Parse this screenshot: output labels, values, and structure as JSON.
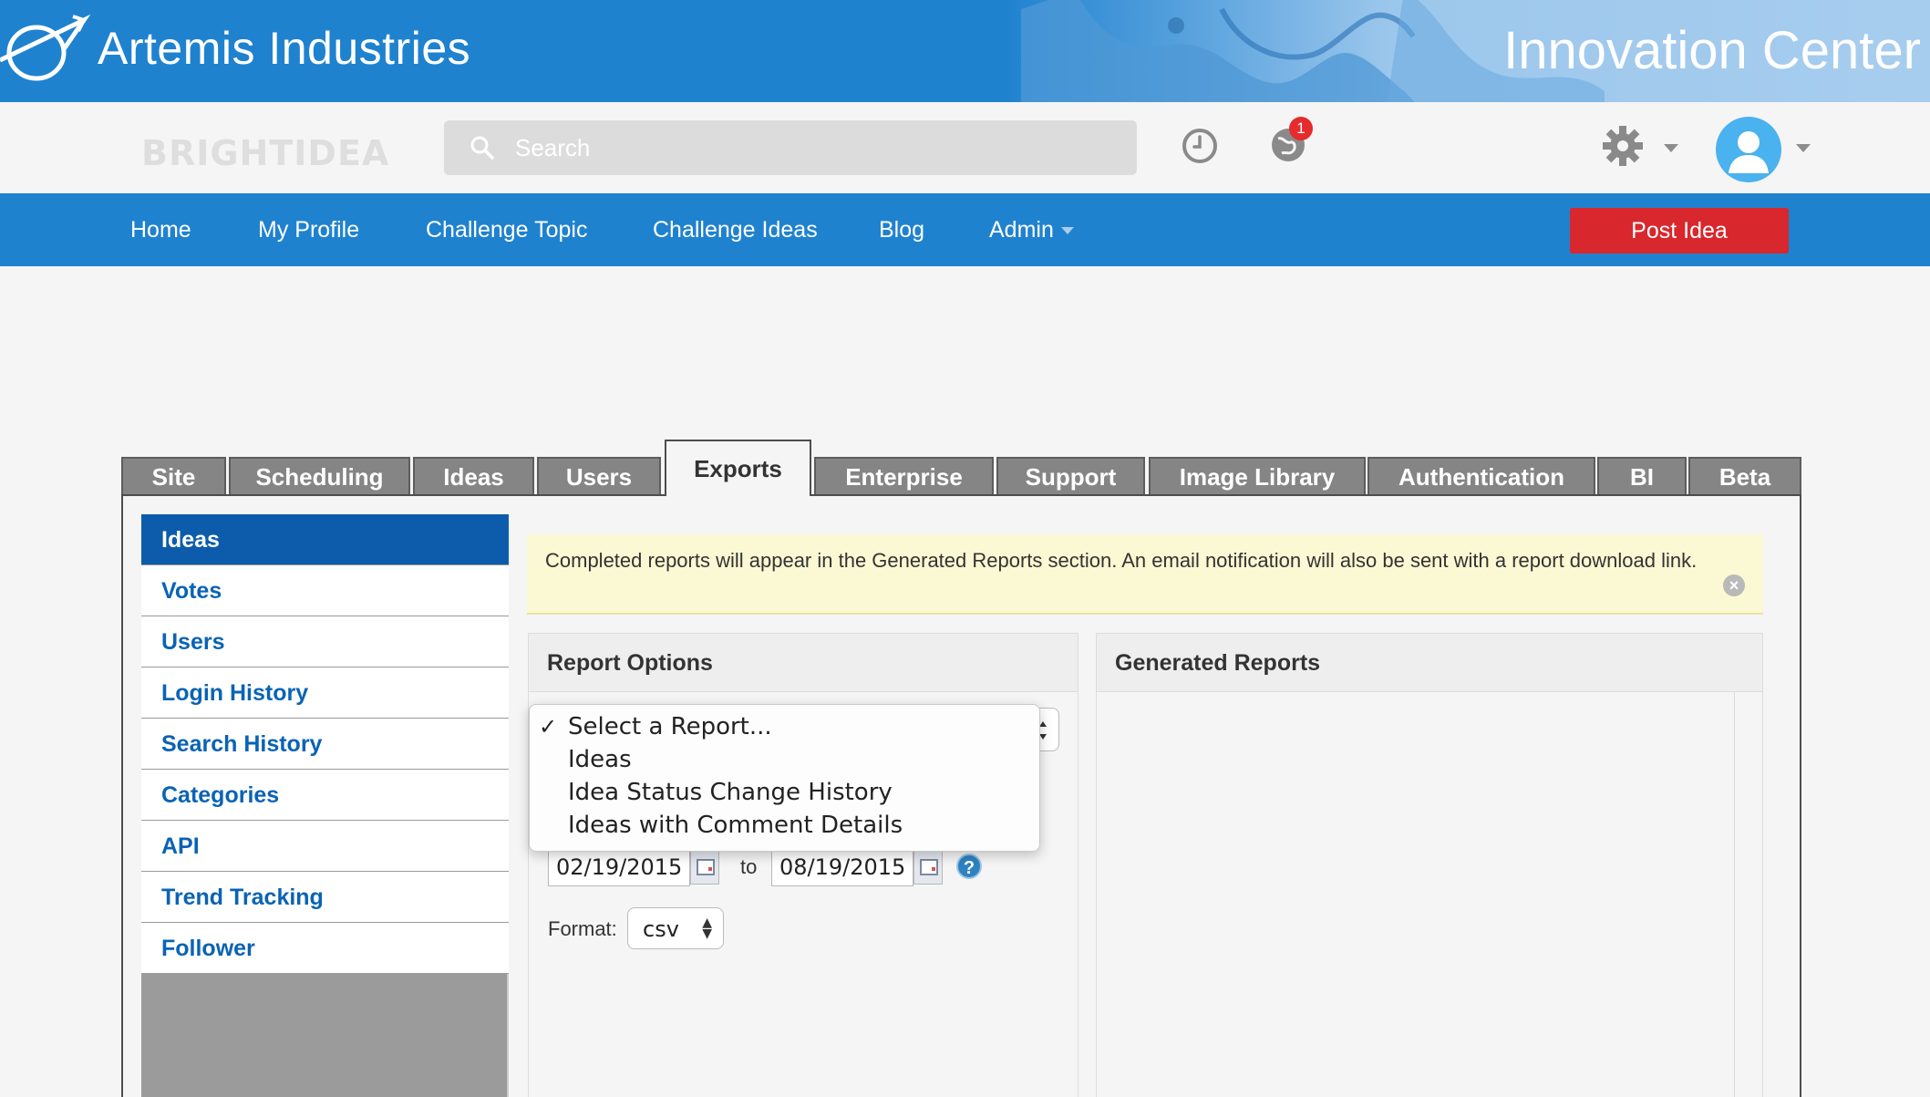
{
  "banner": {
    "company": "Artemis Industries",
    "title": "Innovation Center"
  },
  "utility": {
    "brand": "BRIGHTIDEA",
    "search_placeholder": "Search",
    "notification_count": "1"
  },
  "nav": {
    "items": [
      "Home",
      "My Profile",
      "Challenge Topic",
      "Challenge Ideas",
      "Blog",
      "Admin"
    ],
    "post_idea": "Post Idea"
  },
  "tabs": [
    "Site",
    "Scheduling",
    "Ideas",
    "Users",
    "Exports",
    "Enterprise",
    "Support",
    "Image Library",
    "Authentication",
    "BI",
    "Beta"
  ],
  "active_tab": "Exports",
  "sidebar": {
    "items": [
      "Ideas",
      "Votes",
      "Users",
      "Login History",
      "Search History",
      "Categories",
      "API",
      "Trend Tracking",
      "Follower"
    ],
    "active": "Ideas"
  },
  "notice": "Completed reports will appear in the Generated Reports section. An email notification will also be sent with a report download link.",
  "report_options": {
    "title": "Report Options",
    "dropdown_options": [
      "Select a Report...",
      "Ideas",
      "Idea Status Change History",
      "Ideas with Comment Details"
    ],
    "selected": "Select a Report...",
    "check_mark": "✓",
    "date_from": "02/19/2015",
    "date_to": "08/19/2015",
    "to_label": "to",
    "help": "?",
    "format_label": "Format:",
    "format_value": "csv"
  },
  "generated_reports": {
    "title": "Generated Reports"
  },
  "colors": {
    "banner_blue": "#1f82cf",
    "nav_blue": "#1f82cf",
    "post_idea_red": "#d8272d",
    "sidebar_active": "#0d5cab",
    "link_blue": "#0a63b5",
    "notice_bg": "#fbf9d3"
  }
}
